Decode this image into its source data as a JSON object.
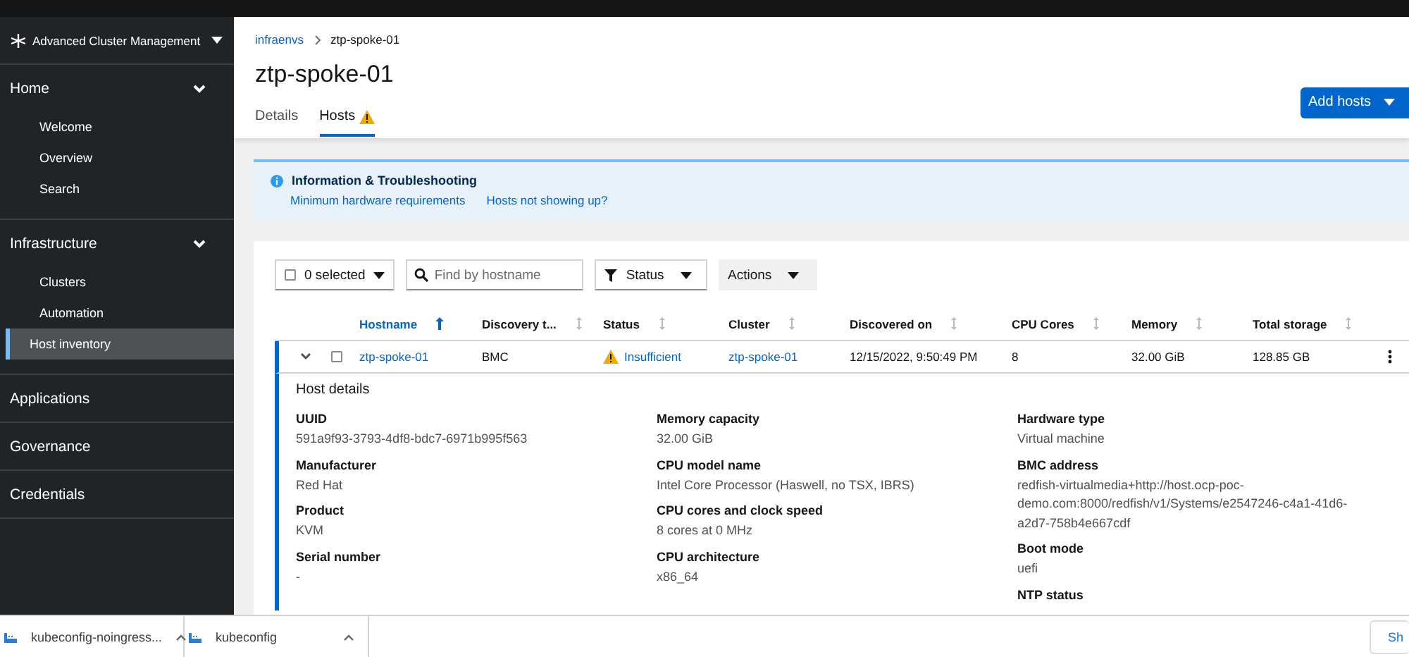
{
  "sidebar": {
    "app_switcher": "Advanced Cluster Management",
    "groups": [
      {
        "label": "Home",
        "expanded": true,
        "children": [
          {
            "label": "Welcome",
            "selected": false
          },
          {
            "label": "Overview",
            "selected": false
          },
          {
            "label": "Search",
            "selected": false
          }
        ]
      },
      {
        "label": "Infrastructure",
        "expanded": true,
        "children": [
          {
            "label": "Clusters",
            "selected": false
          },
          {
            "label": "Automation",
            "selected": false
          },
          {
            "label": "Host inventory",
            "selected": true
          }
        ]
      },
      {
        "label": "Applications",
        "expanded": false
      },
      {
        "label": "Governance",
        "expanded": false
      },
      {
        "label": "Credentials",
        "expanded": false
      }
    ]
  },
  "breadcrumb": [
    {
      "label": "infraenvs",
      "kind": "link"
    },
    {
      "label": "ztp-spoke-01",
      "kind": "current"
    }
  ],
  "title": "ztp-spoke-01",
  "add_button": "Add hosts",
  "tabs": [
    {
      "label": "Details",
      "selected": false,
      "warning": false
    },
    {
      "label": "Hosts",
      "selected": true,
      "warning": true
    }
  ],
  "alert": {
    "title": "Information & Troubleshooting",
    "links": [
      "Minimum hardware requirements",
      "Hosts not showing up?"
    ]
  },
  "toolbar": {
    "bulk_select": {
      "label": "0 selected",
      "checked": false
    },
    "search": {
      "placeholder": "Find by hostname"
    },
    "filter": "Status",
    "actions": "Actions"
  },
  "table": {
    "columns": [
      {
        "label": "Hostname",
        "sorted": true
      },
      {
        "label": "Discovery t...",
        "sorted": false
      },
      {
        "label": "Status",
        "sorted": false
      },
      {
        "label": "Cluster",
        "sorted": false
      },
      {
        "label": "Discovered on",
        "sorted": false
      },
      {
        "label": "CPU Cores",
        "sorted": false
      },
      {
        "label": "Memory",
        "sorted": false
      },
      {
        "label": "Total storage",
        "sorted": false
      }
    ],
    "rows": [
      {
        "expanded": true,
        "checked": false,
        "hostname": "ztp-spoke-01",
        "discovery_type": "BMC",
        "status": "Insufficient",
        "cluster": "ztp-spoke-01",
        "discovered_on": "12/15/2022, 9:50:49 PM",
        "cpu_cores": "8",
        "memory": "32.00 GiB",
        "total_storage": "128.85 GB",
        "details": {
          "title": "Host details",
          "columns": [
            [
              {
                "label": "UUID",
                "value": "591a9f93-3793-4df8-bdc7-6971b995f563"
              },
              {
                "label": "Manufacturer",
                "value": "Red Hat"
              },
              {
                "label": "Product",
                "value": "KVM"
              },
              {
                "label": "Serial number",
                "value": "-"
              }
            ],
            [
              {
                "label": "Memory capacity",
                "value": "32.00 GiB"
              },
              {
                "label": "CPU model name",
                "value": "Intel Core Processor (Haswell, no TSX, IBRS)"
              },
              {
                "label": "CPU cores and clock speed",
                "value": "8 cores at 0 MHz"
              },
              {
                "label": "CPU architecture",
                "value": "x86_64"
              }
            ],
            [
              {
                "label": "Hardware type",
                "value": "Virtual machine"
              },
              {
                "label": "BMC address",
                "value": "redfish-virtualmedia+http://host.ocp-poc-demo.com:8000/redfish/v1/Systems/e2547246-c4a1-41d6-a2d7-758b4e667cdf"
              },
              {
                "label": "Boot mode",
                "value": "uefi"
              },
              {
                "label": "NTP status"
              }
            ]
          ]
        }
      }
    ]
  },
  "downloads": {
    "items": [
      {
        "name": "kubeconfig-noingress..."
      },
      {
        "name": "kubeconfig"
      }
    ],
    "show_all": "Sh"
  }
}
